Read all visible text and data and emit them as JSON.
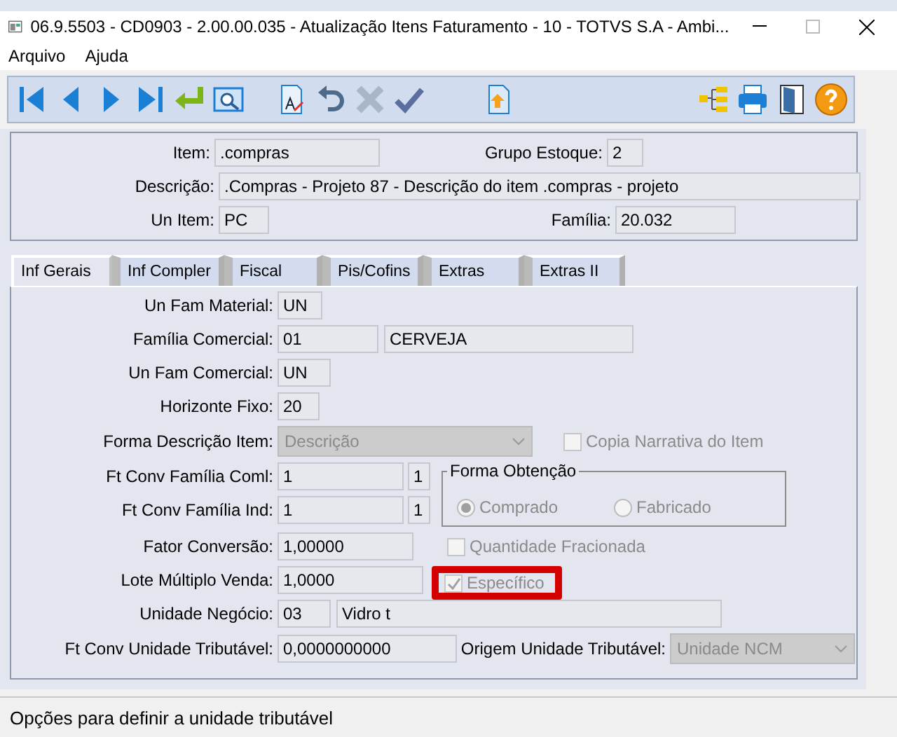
{
  "window": {
    "title": "06.9.5503 - CD0903 - 2.00.00.035 - Atualização Itens Faturamento - 10 - TOTVS S.A - Ambi..."
  },
  "menu": [
    "Arquivo",
    "Ajuda"
  ],
  "header": {
    "item": {
      "label": "Item:",
      "value": ".compras"
    },
    "grupo_estoque": {
      "label": "Grupo Estoque:",
      "value": "2"
    },
    "descricao": {
      "label": "Descrição:",
      "value": ".Compras - Projeto 87 - Descrição do item .compras - projeto"
    },
    "un_item": {
      "label": "Un Item:",
      "value": "PC"
    },
    "familia": {
      "label": "Família:",
      "value": "20.032"
    }
  },
  "tabs": [
    {
      "label": "Inf Gerais",
      "selected": true
    },
    {
      "label": "Inf Compler",
      "selected": false
    },
    {
      "label": "Fiscal",
      "selected": false
    },
    {
      "label": "Pis/Cofins",
      "selected": false
    },
    {
      "label": "Extras",
      "selected": false
    },
    {
      "label": "Extras II",
      "selected": false
    }
  ],
  "form": {
    "un_fam_material": {
      "label": "Un Fam Material:",
      "value": "UN"
    },
    "familia_comercial": {
      "label": "Família Comercial:",
      "value": "01",
      "description": "CERVEJA"
    },
    "un_fam_comercial": {
      "label": "Un Fam Comercial:",
      "value": "UN"
    },
    "horizonte_fixo": {
      "label": "Horizonte Fixo:",
      "value": "20"
    },
    "forma_descricao": {
      "label": "Forma Descrição Item:",
      "value": "Descrição",
      "disabled": true
    },
    "copia_narrativa": {
      "label": "Copia Narrativa do Item",
      "checked": false,
      "disabled": true
    },
    "ft_conv_familia_coml": {
      "label": "Ft Conv Família Coml:",
      "value": "1",
      "unit": "1"
    },
    "ft_conv_familia_ind": {
      "label": "Ft Conv Família Ind:",
      "value": "1",
      "unit": "1"
    },
    "forma_obtencao": {
      "title": "Forma Obtenção",
      "options": [
        {
          "label": "Comprado",
          "selected": true,
          "disabled": true
        },
        {
          "label": "Fabricado",
          "selected": false,
          "disabled": true
        }
      ]
    },
    "fator_conversao": {
      "label": "Fator Conversão:",
      "value": "1,00000"
    },
    "quantidade_fracionada": {
      "label": "Quantidade Fracionada",
      "checked": false,
      "disabled": true
    },
    "lote_multiplo": {
      "label": "Lote Múltiplo Venda:",
      "value": "1,0000"
    },
    "especifico": {
      "label": "Específico",
      "checked": true,
      "disabled": true,
      "highlighted": true
    },
    "unidade_negocio": {
      "label": "Unidade Negócio:",
      "value": "03",
      "description": "Vidro t"
    },
    "ft_conv_unidade_tributavel": {
      "label": "Ft Conv Unidade Tributável:",
      "value": "0,0000000000"
    },
    "origem_unidade_tributavel": {
      "label": "Origem Unidade Tributável:",
      "value": "Unidade NCM",
      "disabled": true
    }
  },
  "status_bar": {
    "text": "Opções para definir a unidade tributável"
  }
}
